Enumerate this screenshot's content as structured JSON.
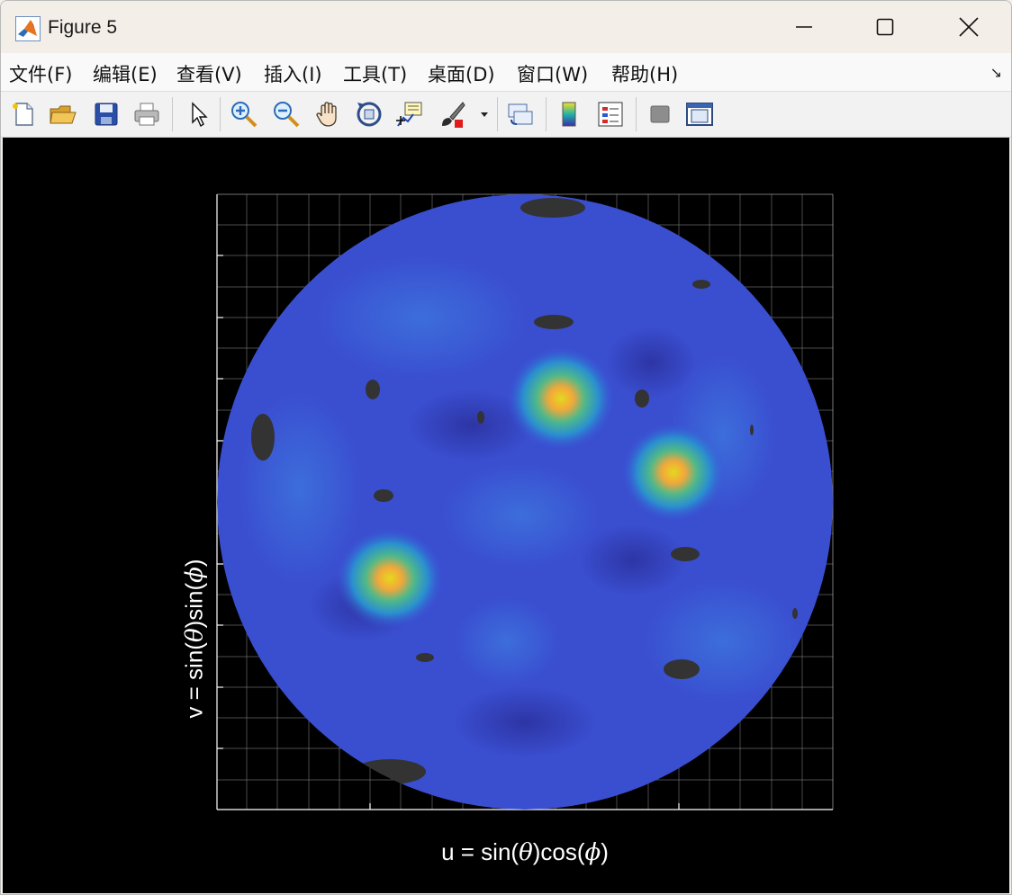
{
  "window": {
    "title": "Figure 5",
    "icons": [
      "matlab-logo-icon",
      "minimize-icon",
      "maximize-icon",
      "close-icon"
    ]
  },
  "menu": {
    "items": [
      {
        "label": "文件(F)",
        "name": "menu-file"
      },
      {
        "label": "编辑(E)",
        "name": "menu-edit"
      },
      {
        "label": "查看(V)",
        "name": "menu-view"
      },
      {
        "label": "插入(I)",
        "name": "menu-insert"
      },
      {
        "label": "工具(T)",
        "name": "menu-tools"
      },
      {
        "label": "桌面(D)",
        "name": "menu-desktop"
      },
      {
        "label": "窗口(W)",
        "name": "menu-window"
      },
      {
        "label": "帮助(H)",
        "name": "menu-help"
      }
    ],
    "dock_glyph": "↘"
  },
  "toolbar": {
    "icons": [
      "new-figure-icon",
      "open-folder-icon",
      "save-icon",
      "print-icon",
      "pointer-icon",
      "zoom-in-icon",
      "zoom-out-icon",
      "pan-hand-icon",
      "rotate-3d-icon",
      "data-cursor-icon",
      "brush-icon",
      "brush-dropdown-icon",
      "link-plot-icon",
      "colorbar-icon",
      "legend-icon",
      "hide-plot-tools-icon",
      "show-plot-tools-icon"
    ]
  },
  "plot": {
    "xlabel_prefix": "u = sin(",
    "xlabel_theta": "θ",
    "xlabel_mid": ")cos(",
    "xlabel_phi": "ϕ",
    "xlabel_suffix": ")",
    "ylabel_prefix": "v = sin(",
    "ylabel_theta": "θ",
    "ylabel_mid": ")sin(",
    "ylabel_phi": "ϕ",
    "ylabel_suffix": ")",
    "colors": {
      "background": "#000000",
      "disk_base": "#3a4ed0",
      "peak": "#f2b83a",
      "grid": "#8a8a8a",
      "nulls": "#333333"
    },
    "peaks": [
      {
        "u": 0.12,
        "v": 0.38,
        "level": 1.0
      },
      {
        "u": 0.48,
        "v": 0.1,
        "level": 0.9
      },
      {
        "u": -0.44,
        "v": -0.26,
        "level": 0.9
      }
    ]
  },
  "chart_data": {
    "type": "heatmap",
    "xlabel": "u = sin(θ)cos(ϕ)",
    "ylabel": "v = sin(θ)sin(ϕ)",
    "xlim": [
      -1,
      1
    ],
    "ylim": [
      -1,
      1
    ],
    "grid": true,
    "colormap": "parula"
  }
}
